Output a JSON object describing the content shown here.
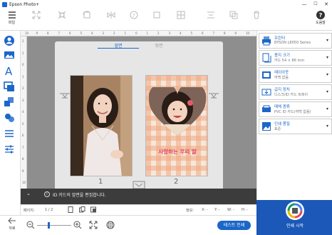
{
  "window": {
    "title": "Epson Photo+",
    "minimize": "—",
    "maximize": "☐",
    "close": "✕"
  },
  "toolbar": {
    "menu_label": "파일",
    "help_label": "도움말",
    "disabled_tools": [
      "",
      "",
      "",
      "",
      "",
      "",
      "",
      "",
      "",
      ""
    ],
    "accent": "#1b66c9"
  },
  "left_tools": [
    "person-icon",
    "image-icon",
    "text-icon",
    "frame-icon",
    "layers-icon",
    "stamp-icon",
    "arrange-icon",
    "adjust-icon"
  ],
  "ruler": {
    "top_numbers": [
      "10",
      "9",
      "8",
      "7",
      "6",
      "5",
      "4",
      "3",
      "2",
      "1",
      "0",
      "1",
      "2",
      "3",
      "4",
      "5",
      "6",
      "7",
      "8",
      "9",
      "10"
    ],
    "left_numbers": [
      "2",
      "1",
      "0",
      "1",
      "2",
      "3",
      "4",
      "5",
      "6",
      "7",
      "8",
      "9",
      "10"
    ]
  },
  "canvas": {
    "tabs": {
      "front": "앞면",
      "back": "뒷면"
    },
    "card1_number": "1",
    "card2_number": "2",
    "card2_caption": "사랑하는 우리 딸"
  },
  "infobar": {
    "message": "ID 카드의 앞면을 편집합니다.",
    "expand_icon": "chevron-down-icon",
    "info_icon": "info-icon"
  },
  "statusbar": {
    "page_label": "페이지:",
    "page_value": "1 / 2",
    "info_label": "정보:",
    "x_label": "X: -",
    "y_label": "Y: -",
    "w_label": "W: -",
    "h_label": "H: -"
  },
  "right_panel": {
    "items": [
      {
        "title": "프린터",
        "value": "EPSON L8050 Series",
        "icon": "printer-icon"
      },
      {
        "title": "용지 크기",
        "value": "카드 54 × 86 mm",
        "icon": "paper-size-icon"
      },
      {
        "title": "레이아웃",
        "value": "여백 없음",
        "icon": "layout-icon"
      },
      {
        "title": "급지 장치",
        "value": "디스크/ID 카드 트레이",
        "icon": "tray-icon"
      },
      {
        "title": "매체 종류",
        "value": "PVC ID 카드(여백 없음)",
        "icon": "media-type-icon"
      },
      {
        "title": "인쇄 품질",
        "value": "표준",
        "icon": "quality-icon"
      }
    ],
    "print_label": "인쇄 시작"
  },
  "bottom": {
    "back_label": "뒤로",
    "test_print_label": "테스트 인쇄",
    "zoom_value": 0.35
  }
}
